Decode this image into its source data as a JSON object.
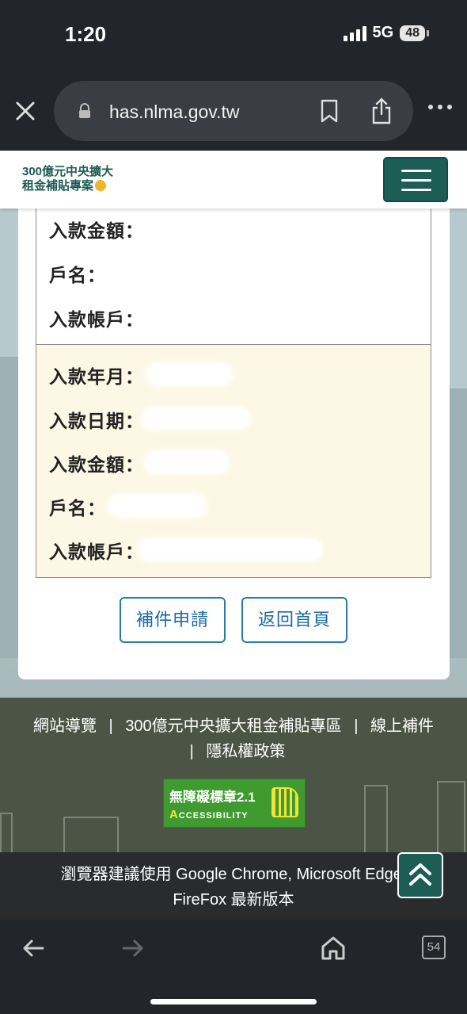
{
  "status_bar": {
    "time": "1:20",
    "network": "5G",
    "battery": "48"
  },
  "browser": {
    "url": "has.nlma.gov.tw",
    "tab_count": "54"
  },
  "site": {
    "logo_line1": "300億元中央擴大",
    "logo_line2": "租金補貼專案"
  },
  "account_section": {
    "rows": [
      {
        "label": "入款金額："
      },
      {
        "label": "戶名："
      },
      {
        "label": "入款帳戶："
      }
    ]
  },
  "deposit_section": {
    "rows": [
      {
        "label": "入款年月："
      },
      {
        "label": "入款日期："
      },
      {
        "label": "入款金額："
      },
      {
        "label": "戶名："
      },
      {
        "label": "入款帳戶："
      }
    ]
  },
  "buttons": {
    "supplement": "補件申請",
    "home": "返回首頁"
  },
  "footer": {
    "links": [
      "網站導覽",
      "300億元中央擴大租金補貼專區",
      "線上補件",
      "隱私權政策"
    ],
    "separator": "|",
    "badge_title": "無障礙標章2.1",
    "badge_sub": "CCESSIBILITY",
    "badge_letter": "A"
  },
  "notice": {
    "line1": "瀏覽器建議使用 Google Chrome, Microsoft Edge,",
    "line2": "FireFox 最新版本"
  },
  "colors": {
    "brand": "#1c5d55",
    "button_border": "#2a7aa7",
    "highlight_bg": "#fdf8e6",
    "footer_bg": "#4c5446"
  }
}
